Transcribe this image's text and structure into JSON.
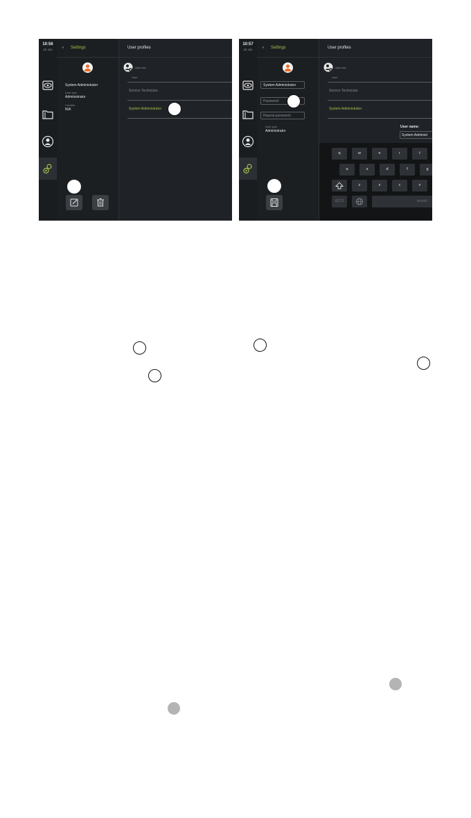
{
  "screen1": {
    "time": "10:56",
    "date": "18 Jan",
    "settings_label": "Settings",
    "back_glyph": "‹",
    "panel_title": "User profiles",
    "profile_name": "System Administrator",
    "user_type_label": "User type",
    "user_type_value": "Administrator",
    "created_label": "Created",
    "created_value": "N/A",
    "add_user_label": "Add user",
    "list_header": "User",
    "users": [
      "Service Technician",
      "System Administrator"
    ]
  },
  "screen2": {
    "time": "10:57",
    "date": "18 Jan",
    "settings_label": "Settings",
    "back_glyph": "‹",
    "panel_title": "User profiles",
    "name_field_value": "System Administrator",
    "password_placeholder": "Password:",
    "repeat_password_placeholder": "Repeat password:",
    "user_type_label": "User type",
    "user_type_value": "Administrator",
    "add_user_label": "Add user",
    "list_header": "User",
    "users": [
      "Service Technician",
      "System Administrator"
    ],
    "user_name_label": "User name:",
    "user_name_value": "System Administ",
    "keyboard": {
      "row1": [
        "q",
        "w",
        "e",
        "r",
        "t"
      ],
      "row2": [
        "a",
        "s",
        "d",
        "f",
        "g"
      ],
      "row3": [
        "z",
        "x",
        "c",
        "v"
      ],
      "numbers_key": "&123",
      "space_label": "anosh"
    }
  },
  "colors": {
    "accent_green": "#a4c14a",
    "avatar_orange": "#e8702a",
    "screen_background": "#1e2226",
    "callout_grey": "#b4b4b4"
  },
  "icons": [
    "chevron-left-icon",
    "user-avatar-icon",
    "add-user-icon",
    "eye-icon",
    "folder-icon",
    "user-icon",
    "gear-icon",
    "edit-icon",
    "trash-icon",
    "save-icon",
    "shift-icon",
    "globe-icon"
  ]
}
